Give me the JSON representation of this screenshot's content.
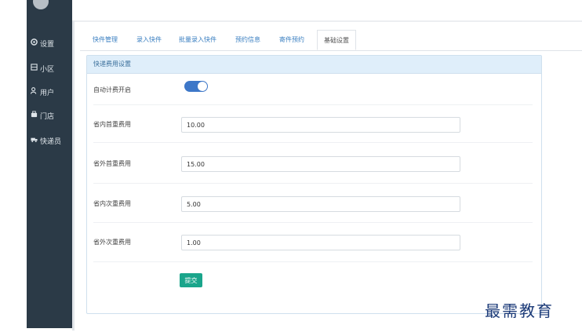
{
  "sidebar": {
    "items": [
      {
        "icon": "gear-icon",
        "label": "设置"
      },
      {
        "icon": "building-icon",
        "label": "小区"
      },
      {
        "icon": "user-icon",
        "label": "用户"
      },
      {
        "icon": "store-icon",
        "label": "门店"
      },
      {
        "icon": "courier-icon",
        "label": "快递员"
      }
    ]
  },
  "tabs": [
    {
      "label": "快件管理"
    },
    {
      "label": "录入快件"
    },
    {
      "label": "批量录入快件"
    },
    {
      "label": "预约信息"
    },
    {
      "label": "寄件预约"
    },
    {
      "label": "基础设置",
      "active": true
    }
  ],
  "panel": {
    "title": "快递费用设置",
    "auto_billing_label": "自动计费开启",
    "auto_billing_on": true,
    "fields": [
      {
        "label": "省内首重费用",
        "value": "10.00"
      },
      {
        "label": "省外首重费用",
        "value": "15.00"
      },
      {
        "label": "省内次重费用",
        "value": "5.00"
      },
      {
        "label": "省外次重费用",
        "value": "1.00"
      }
    ],
    "submit_label": "提交"
  },
  "watermark": "最需教育",
  "colors": {
    "sidebar": "#2b3a47",
    "accent": "#3d77c8",
    "submit": "#1aa58b",
    "heading_bg": "#dfeefa"
  }
}
